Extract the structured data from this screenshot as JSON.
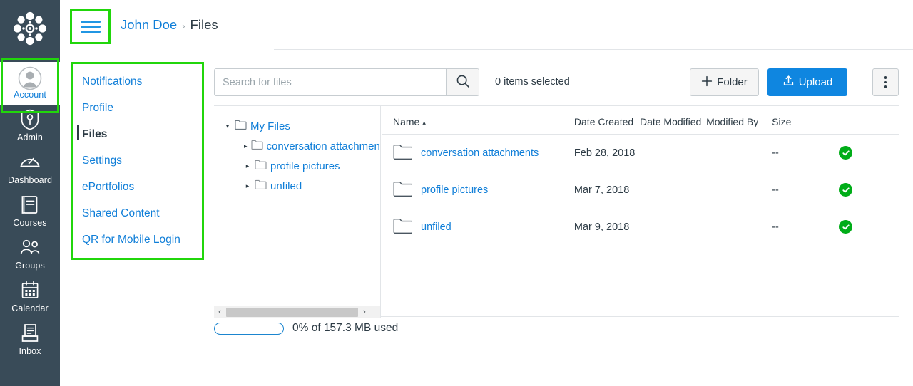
{
  "global_nav": {
    "logo": "canvas-logo-icon",
    "items": [
      {
        "label": "Account",
        "icon": "user-avatar-icon",
        "active": true
      },
      {
        "label": "Admin",
        "icon": "shield-wrench-icon",
        "active": false
      },
      {
        "label": "Dashboard",
        "icon": "dashboard-speedometer-icon",
        "active": false
      },
      {
        "label": "Courses",
        "icon": "book-icon",
        "active": false
      },
      {
        "label": "Groups",
        "icon": "people-group-icon",
        "active": false
      },
      {
        "label": "Calendar",
        "icon": "calendar-icon",
        "active": false
      },
      {
        "label": "Inbox",
        "icon": "inbox-tray-icon",
        "active": false
      }
    ]
  },
  "header": {
    "menu_icon": "hamburger-menu-icon",
    "breadcrumb": {
      "user": "John Doe",
      "separator": "›",
      "current": "Files"
    }
  },
  "section_nav": {
    "items": [
      {
        "label": "Notifications",
        "active": false
      },
      {
        "label": "Profile",
        "active": false
      },
      {
        "label": "Files",
        "active": true
      },
      {
        "label": "Settings",
        "active": false
      },
      {
        "label": "ePortfolios",
        "active": false
      },
      {
        "label": "Shared Content",
        "active": false
      },
      {
        "label": "QR for Mobile Login",
        "active": false
      }
    ]
  },
  "toolbar": {
    "search": {
      "value": "",
      "placeholder": "Search for files",
      "icon": "search-icon"
    },
    "selected_count_label": "0 items selected",
    "folder_button": {
      "label": "Folder",
      "icon": "plus-icon"
    },
    "upload_button": {
      "label": "Upload",
      "icon": "upload-arrow-icon"
    },
    "kebab_button": {
      "icon": "kebab-menu-icon"
    }
  },
  "tree": {
    "root": {
      "label": "My Files",
      "expanded": true,
      "twisty": "▾",
      "icon": "folder-icon"
    },
    "children": [
      {
        "label": "conversation attachments",
        "expanded": false,
        "twisty": "▸",
        "icon": "folder-icon"
      },
      {
        "label": "profile pictures",
        "expanded": false,
        "twisty": "▸",
        "icon": "folder-icon"
      },
      {
        "label": "unfiled",
        "expanded": false,
        "twisty": "▸",
        "icon": "folder-icon"
      }
    ],
    "scrollbar": {
      "left_arrow": "‹",
      "right_arrow": "›"
    }
  },
  "file_table": {
    "columns": [
      {
        "label": "Name",
        "sorted": "asc",
        "caret": "▴"
      },
      {
        "label": "Date Created"
      },
      {
        "label": "Date Modified"
      },
      {
        "label": "Modified By"
      },
      {
        "label": "Size"
      }
    ],
    "rows": [
      {
        "icon": "folder-icon",
        "name": "conversation attachments",
        "date_created": "Feb 28, 2018",
        "date_modified": "",
        "modified_by": "",
        "size": "--",
        "published": "published-check-icon"
      },
      {
        "icon": "folder-icon",
        "name": "profile pictures",
        "date_created": "Mar 7, 2018",
        "date_modified": "",
        "modified_by": "",
        "size": "--",
        "published": "published-check-icon"
      },
      {
        "icon": "folder-icon",
        "name": "unfiled",
        "date_created": "Mar 9, 2018",
        "date_modified": "",
        "modified_by": "",
        "size": "--",
        "published": "published-check-icon"
      }
    ]
  },
  "quota": {
    "percent": 0,
    "label": "0% of 157.3 MB used"
  },
  "colors": {
    "nav_background": "#394B58",
    "link_blue": "#0f7ed8",
    "primary_blue": "#0f86e0",
    "published_green": "#00ad18",
    "highlight_green": "#21d60b",
    "text_dark": "#2d3b45",
    "border_gray": "#e2e5e8"
  }
}
